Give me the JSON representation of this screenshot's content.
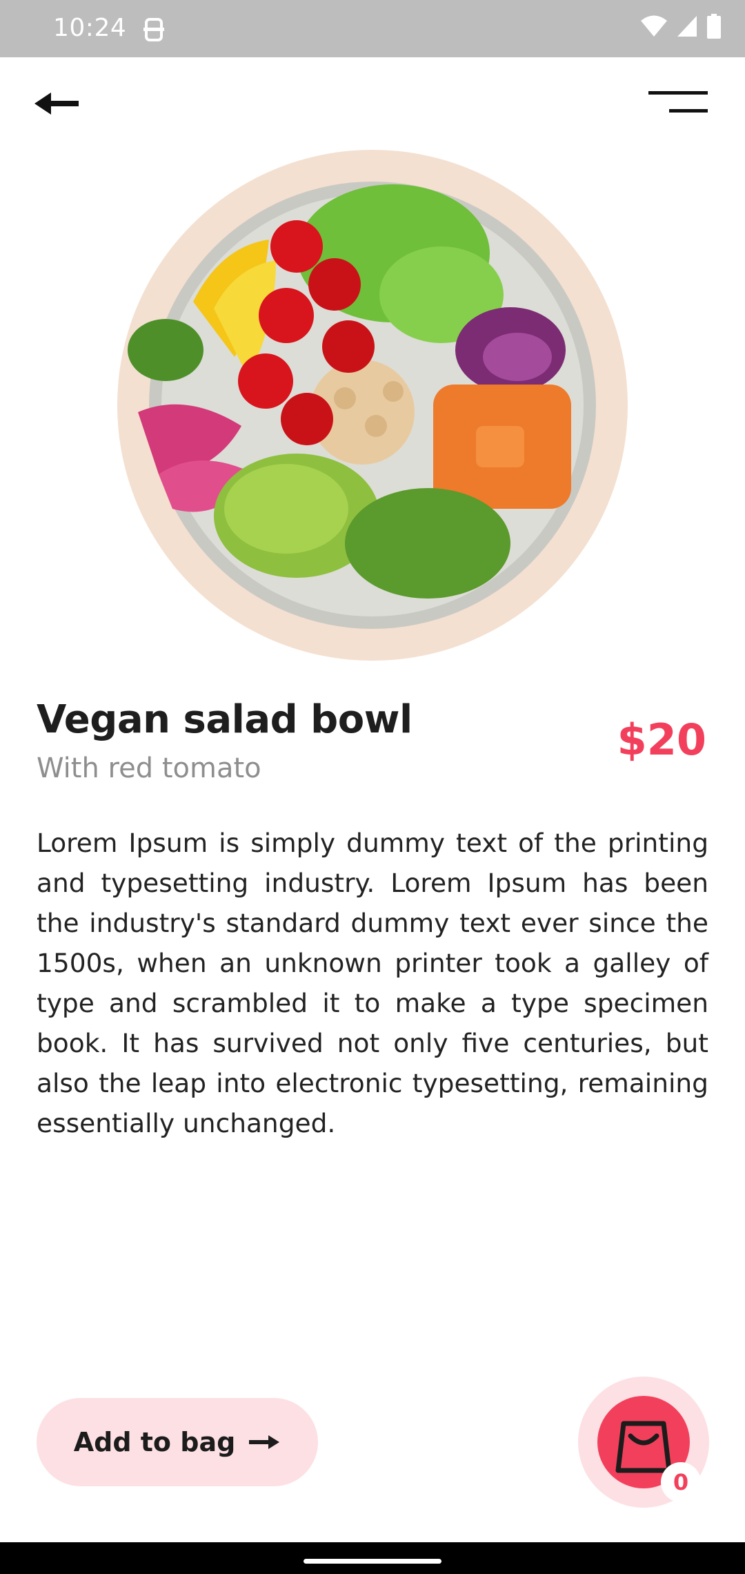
{
  "status_bar": {
    "time": "10:24",
    "icons": [
      "notification-icon",
      "wifi-icon",
      "signal-icon",
      "battery-icon"
    ]
  },
  "toolbar": {
    "back_icon": "arrow-left-icon",
    "menu_icon": "menu-icon"
  },
  "product": {
    "title": "Vegan salad bowl",
    "subtitle": "With red tomato",
    "price": "$20",
    "description": "Lorem Ipsum is simply dummy text of the printing and typesetting industry. Lorem Ipsum has been the industry's standard dummy text ever since the 1500s, when an unknown printer took a galley of type and scrambled it to make a type specimen book. It has survived not only five centuries, but also the leap into electronic typesetting, remaining essentially unchanged.",
    "image_alt": "salad bowl"
  },
  "actions": {
    "add_to_bag_label": "Add to bag",
    "bag_count": "0"
  },
  "colors": {
    "accent": "#f2405c",
    "accent_light": "#fde0e4",
    "plate_bg": "#f4e0d0",
    "status_bar": "#bdbdbd"
  }
}
